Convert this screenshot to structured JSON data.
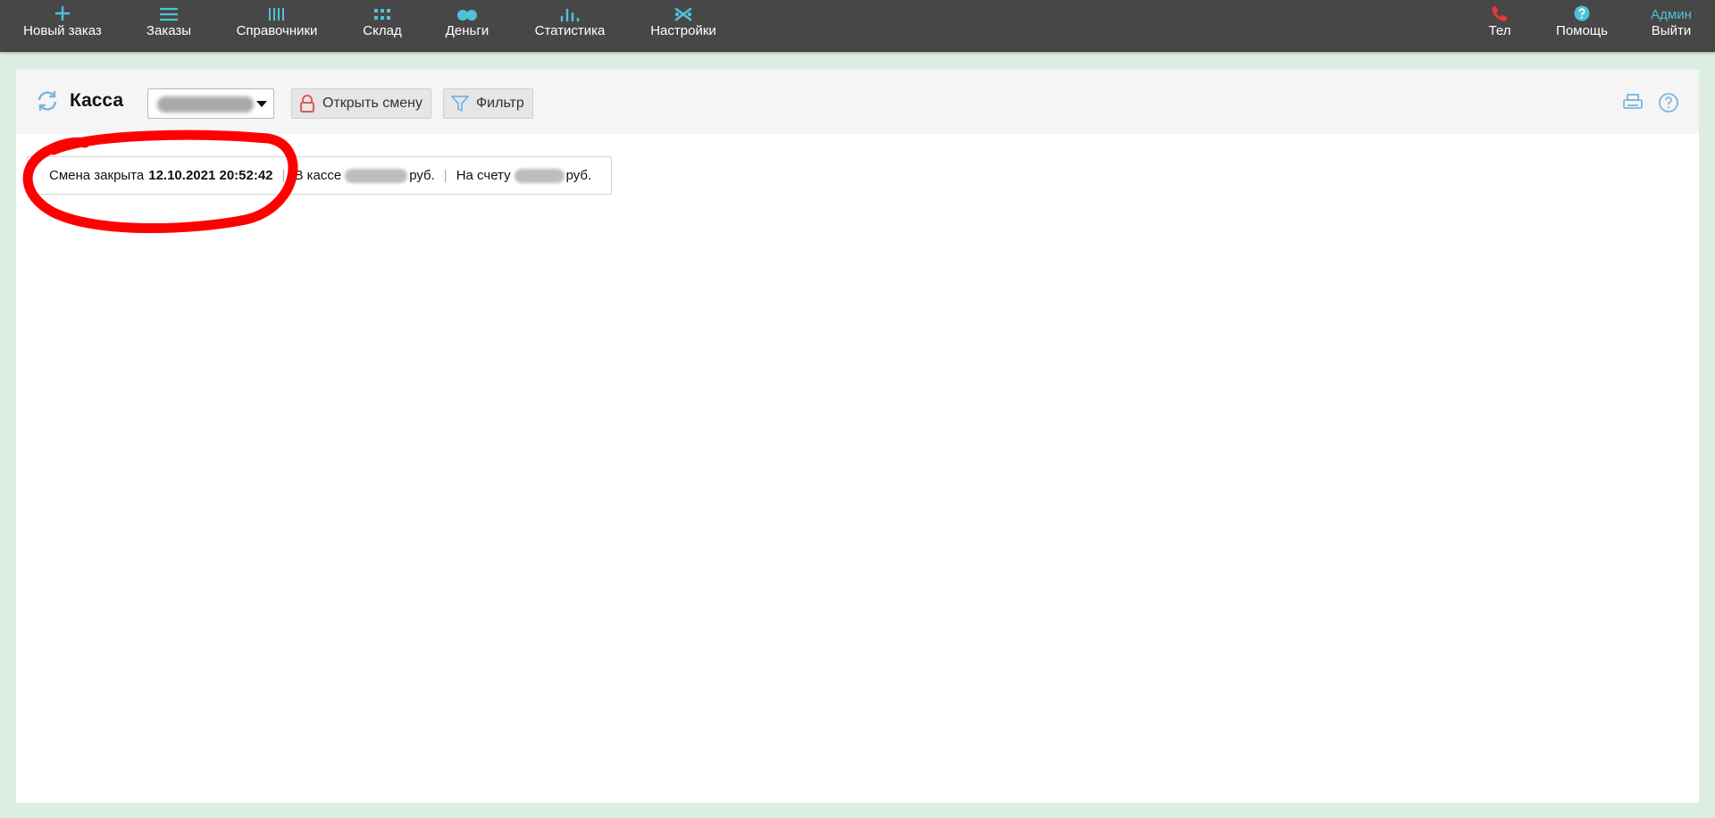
{
  "nav": {
    "new_order": "Новый заказ",
    "orders": "Заказы",
    "directories": "Справочники",
    "warehouse": "Склад",
    "money": "Деньги",
    "statistics": "Статистика",
    "settings": "Настройки",
    "phone": "Тел",
    "help": "Помощь",
    "user": "Админ",
    "logout": "Выйти"
  },
  "header": {
    "title": "Касса",
    "open_shift": "Открыть смену",
    "filter": "Фильтр"
  },
  "status": {
    "shift_label": "Смена закрыта",
    "shift_datetime": "12.10.2021 20:52:42",
    "cash_label": "В кассе",
    "cash_unit": "руб.",
    "account_label": "На счету",
    "account_unit": "руб.",
    "separator": "|"
  },
  "colors": {
    "navbar": "#474747",
    "accent": "#4cc3d9",
    "phone": "#e53935",
    "lock": "#e05a5a",
    "annotation": "#ff0000",
    "background": "#dcede3"
  },
  "icons": {
    "new_order": "plus-icon",
    "orders": "list-icon",
    "directories": "columns-icon",
    "warehouse": "grid-icon",
    "money": "coins-icon",
    "statistics": "bar-chart-icon",
    "settings": "tools-icon",
    "phone": "phone-icon",
    "help": "help-circle-icon",
    "refresh": "refresh-icon",
    "open_shift": "lock-icon",
    "filter": "funnel-icon",
    "print": "printer-icon",
    "header_help": "question-icon"
  }
}
